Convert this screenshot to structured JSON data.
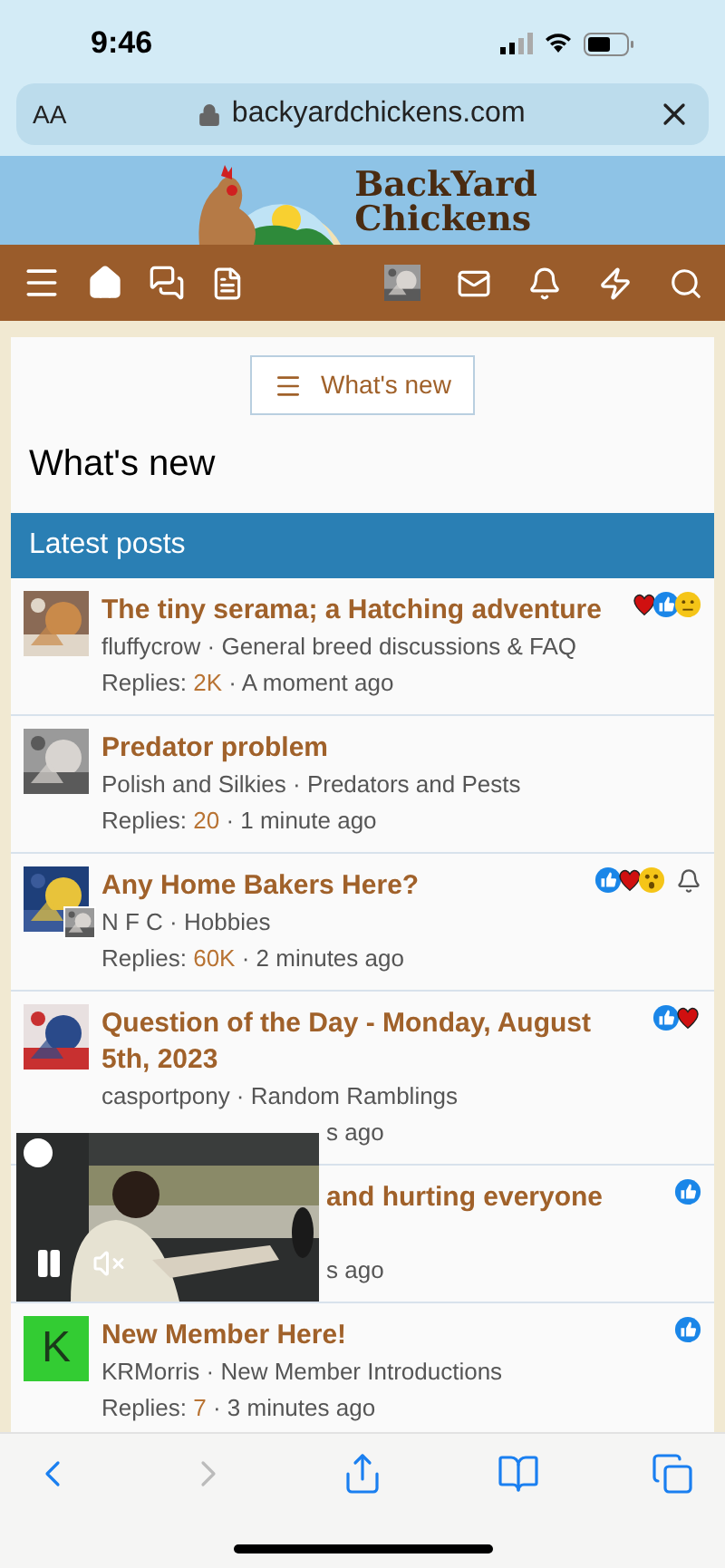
{
  "status_bar": {
    "time": "9:46"
  },
  "browser": {
    "text_size": "AA",
    "url": "backyardchickens.com"
  },
  "banner": {
    "logo_line_1": "BackYard",
    "logo_line_2": "Chickens"
  },
  "whats_new_button": "What's new",
  "heading": "What's new",
  "section_title": "Latest posts",
  "posts": [
    {
      "kind": "full",
      "title": "The tiny serama; a Hatching adventure",
      "meta": "fluffycrow · General breed discussions & FAQ",
      "replies_label": "Replies:",
      "replies_count": "2K",
      "time": "· A moment ago",
      "reactions": [
        {
          "kind": "heart"
        },
        {
          "kind": "like"
        },
        {
          "kind": "meh"
        }
      ],
      "watching": false
    },
    {
      "kind": "full",
      "title": "Predator problem",
      "meta": "Polish and Silkies · Predators and Pests",
      "replies_label": "Replies:",
      "replies_count": "20",
      "time": "· 1 minute ago",
      "watching": false
    },
    {
      "kind": "full",
      "title": "Any Home Bakers Here?",
      "meta": "N F C · Hobbies",
      "replies_label": "Replies:",
      "replies_count": "60K",
      "time": "· 2 minutes ago",
      "reactions": [
        {
          "kind": "like"
        },
        {
          "kind": "heart"
        },
        {
          "kind": "wow"
        }
      ],
      "watching": true
    },
    {
      "kind": "covered_bottom",
      "title": "Question of the Day - Monday, August 5th, 2023",
      "meta": "casportpony · Random Ramblings",
      "tail": "s ago",
      "reactions": [
        {
          "kind": "like"
        },
        {
          "kind": "heart"
        }
      ],
      "watching": false
    },
    {
      "kind": "covered",
      "title_tail": "and hurting everyone",
      "tail": "s ago",
      "reactions": [
        {
          "kind": "like"
        }
      ],
      "watching": false
    },
    {
      "kind": "full",
      "letter": "K",
      "color": "#33cc33",
      "title": "New Member Here!",
      "meta": "KRMorris · New Member Introductions",
      "replies_label": "Replies:",
      "replies_count": "7",
      "time": "· 3 minutes ago",
      "reactions": [
        {
          "kind": "like"
        }
      ],
      "watching": false
    }
  ],
  "video": {
    "playing": true,
    "muted": true
  },
  "toolbar": [
    {
      "kind": "back",
      "disabled": false
    },
    {
      "kind": "forward",
      "disabled": true
    },
    {
      "kind": "share",
      "disabled": false
    },
    {
      "kind": "bookmarks",
      "disabled": false
    },
    {
      "kind": "tabs",
      "disabled": false
    }
  ]
}
